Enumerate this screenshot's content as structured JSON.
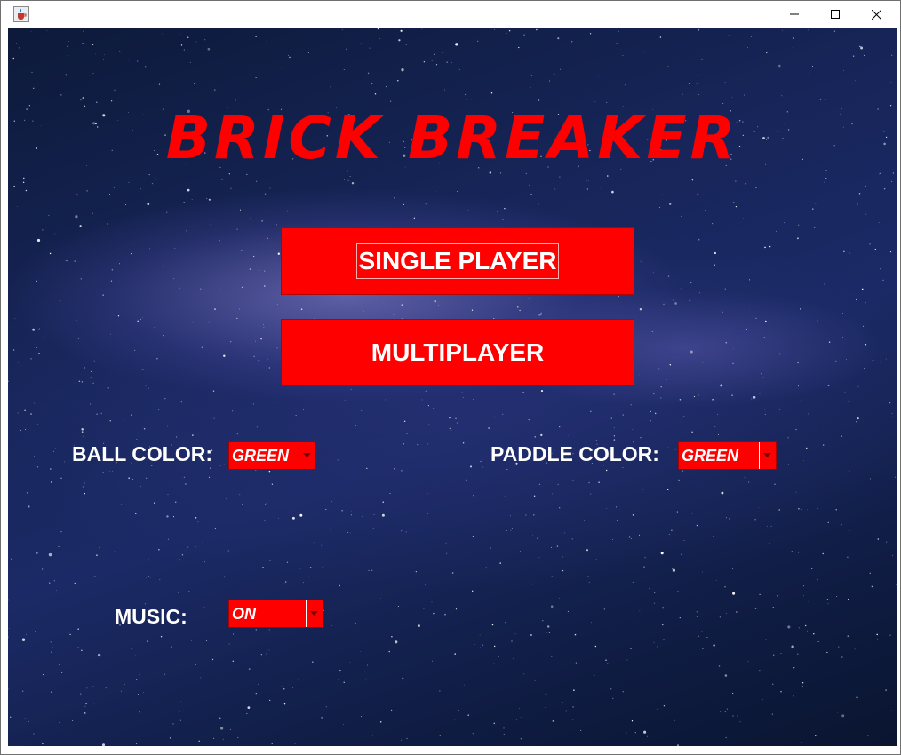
{
  "window": {
    "app_icon": "java-cup-icon",
    "controls": [
      "minimize-icon",
      "maximize-icon",
      "close-icon"
    ]
  },
  "game": {
    "title": "BRICK BREAKER",
    "buttons": {
      "single_player": "SINGLE PLAYER",
      "multiplayer": "MULTIPLAYER"
    },
    "settings": {
      "ball_color_label": "BALL COLOR:",
      "ball_color_value": "GREEN",
      "paddle_color_label": "PADDLE COLOR:",
      "paddle_color_value": "GREEN",
      "music_label": "MUSIC:",
      "music_value": "ON"
    }
  },
  "colors": {
    "accent": "#ff0000",
    "text": "#ffffff",
    "background": "#16235a"
  }
}
